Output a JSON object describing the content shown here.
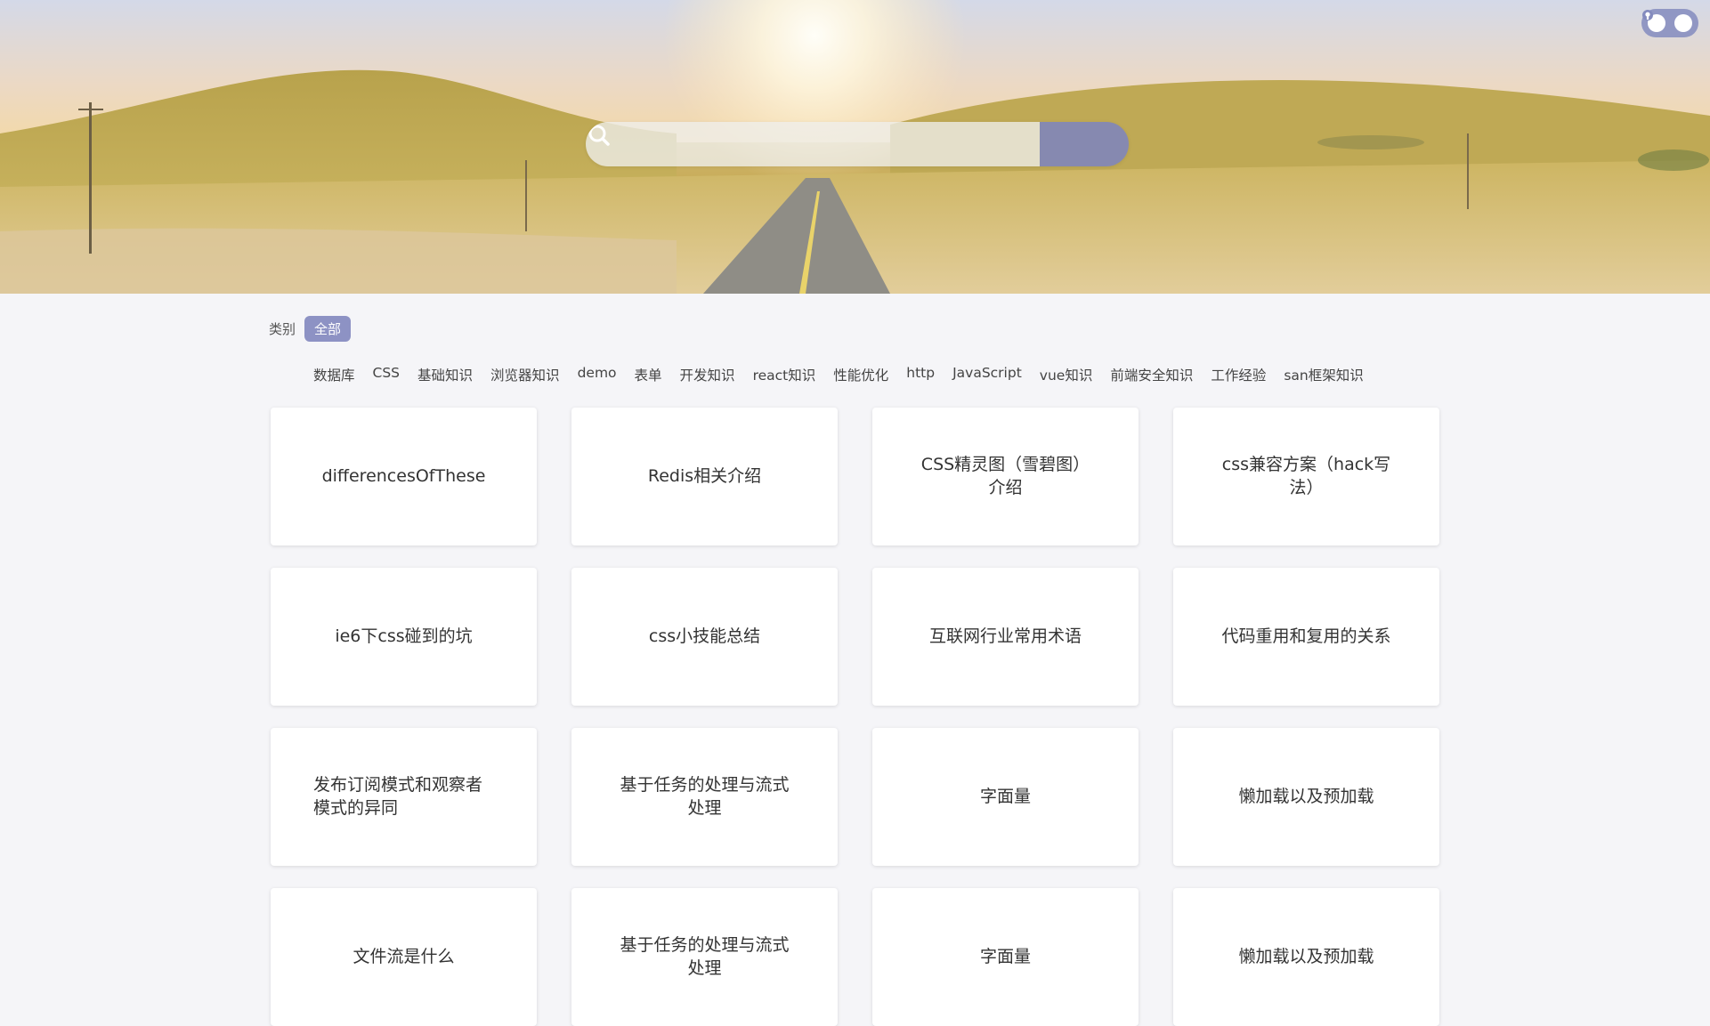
{
  "header": {
    "search": {
      "placeholder": "",
      "value": ""
    },
    "corner_icons": [
      "home-icon",
      "github-icon"
    ]
  },
  "filters": {
    "category_label": "类别",
    "active_category": "全部",
    "tags": [
      "数据库",
      "CSS",
      "基础知识",
      "浏览器知识",
      "demo",
      "表单",
      "开发知识",
      "react知识",
      "性能优化",
      "http",
      "JavaScript",
      "vue知识",
      "前端安全知识",
      "工作经验",
      "san框架知识"
    ]
  },
  "cards": [
    {
      "title": "differencesOfThese"
    },
    {
      "title": "Redis相关介绍"
    },
    {
      "title": "CSS精灵图（雪碧图）介绍"
    },
    {
      "title": "css兼容方案（hack写法）"
    },
    {
      "title": "ie6下css碰到的坑"
    },
    {
      "title": "css小技能总结"
    },
    {
      "title": "互联网行业常用术语"
    },
    {
      "title": "代码重用和复用的关系"
    },
    {
      "title": "发布订阅模式和观察者模式的异同"
    },
    {
      "title": "基于任务的处理与流式处理"
    },
    {
      "title": "字面量"
    },
    {
      "title": "懒加载以及预加载"
    },
    {
      "title": "文件流是什么"
    },
    {
      "title": "基于任务的处理与流式处理"
    },
    {
      "title": "字面量"
    },
    {
      "title": "懒加载以及预加载"
    }
  ],
  "colors": {
    "accent": "#8d92c4",
    "background": "#f5f5f8",
    "card": "#ffffff"
  }
}
